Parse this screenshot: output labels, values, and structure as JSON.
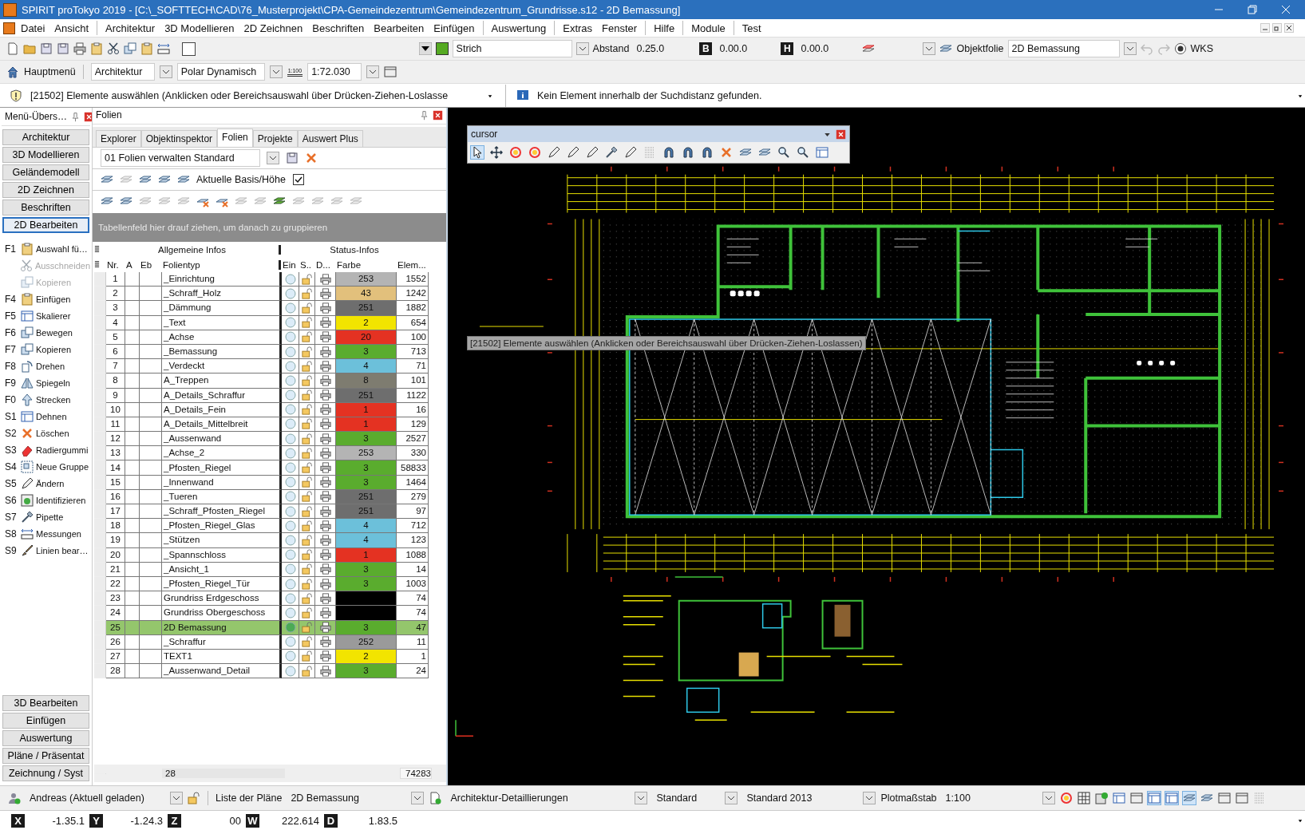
{
  "window": {
    "title": "SPIRIT proTokyo 2019  - [C:\\_SOFTTECH\\CAD\\76_Musterprojekt\\CPA-Gemeindezentrum\\Gemeindezentrum_Grundrisse.s12 - 2D Bemassung]"
  },
  "menu": [
    "Datei",
    "Ansicht",
    "Architektur",
    "3D Modellieren",
    "2D Zeichnen",
    "Beschriften",
    "Bearbeiten",
    "Einfügen",
    "Auswertung",
    "Extras",
    "Fenster",
    "Hilfe",
    "Module",
    "Test"
  ],
  "toolbar": {
    "line_type": "Strich",
    "abstand_label": "Abstand",
    "abstand": "0.25.0",
    "b_key": "B",
    "b_value": "0.00.0",
    "h_key": "H",
    "h_value": "0.00.0",
    "objektfolie": "Objektfolie",
    "folie": "2D Bemassung",
    "wks": "WKS"
  },
  "toolbar2": {
    "home": "Hauptmenü",
    "category": "Architektur",
    "mode": "Polar Dynamisch",
    "scale_icon_text": "1:100",
    "scale": "1:72.030"
  },
  "messages": {
    "prompt": "[21502] Elemente auswählen (Anklicken oder Bereichsauswahl über Drücken-Ziehen-Loslasse",
    "info": "Kein Element innerhalb der Suchdistanz gefunden."
  },
  "menu_panel": {
    "title": "Menü-Übers…",
    "top_buttons": [
      {
        "label": "Architektur",
        "selected": false
      },
      {
        "label": "3D Modellieren",
        "selected": false
      },
      {
        "label": "Geländemodell",
        "selected": false
      },
      {
        "label": "2D Zeichnen",
        "selected": false
      },
      {
        "label": "Beschriften",
        "selected": false
      },
      {
        "label": "2D Bearbeiten",
        "selected": true
      }
    ],
    "functions": [
      {
        "key": "F1",
        "label": "Auswahl fü…",
        "disabled": false
      },
      {
        "label": "Ausschneiden",
        "disabled": true
      },
      {
        "label": "Kopieren",
        "disabled": true
      },
      {
        "key": "F4",
        "label": "Einfügen",
        "disabled": false
      },
      {
        "key": "F5",
        "label": "Skalierer",
        "disabled": false
      },
      {
        "key": "F6",
        "label": "Bewegen",
        "disabled": false
      },
      {
        "key": "F7",
        "label": "Kopieren",
        "disabled": false
      },
      {
        "key": "F8",
        "label": "Drehen",
        "disabled": false
      },
      {
        "key": "F9",
        "label": "Spiegeln",
        "disabled": false
      },
      {
        "key": "F0",
        "label": "Strecken",
        "disabled": false
      },
      {
        "key": "S1",
        "label": "Dehnen",
        "disabled": false
      },
      {
        "key": "S2",
        "label": "Löschen",
        "disabled": false
      },
      {
        "key": "S3",
        "label": "Radiergummi",
        "disabled": false
      },
      {
        "key": "S4",
        "label": "Neue Gruppe",
        "disabled": false
      },
      {
        "key": "S5",
        "label": "Ändern",
        "disabled": false
      },
      {
        "key": "S6",
        "label": "Identifizieren",
        "disabled": false
      },
      {
        "key": "S7",
        "label": "Pipette",
        "disabled": false
      },
      {
        "key": "S8",
        "label": "Messungen",
        "disabled": false
      },
      {
        "key": "S9",
        "label": "Linien bear…",
        "disabled": false
      }
    ],
    "bottom_buttons": [
      "3D Bearbeiten",
      "Einfügen",
      "Auswertung",
      "Pläne / Präsentat",
      "Zeichnung / Syst"
    ]
  },
  "folien_panel": {
    "title": "Folien",
    "tabs": [
      {
        "label": "Explorer",
        "selected": false
      },
      {
        "label": "Objektinspektor",
        "selected": false
      },
      {
        "label": "Folien",
        "selected": true
      },
      {
        "label": "Projekte",
        "selected": false
      },
      {
        "label": "Auswert Plus",
        "selected": false
      }
    ],
    "preset": "01 Folien verwalten Standard",
    "current_base": {
      "label": "Aktuelle Basis/Höhe",
      "checked": true
    },
    "group_hint": "Tabellenfeld hier drauf ziehen, um danach zu gruppieren",
    "table": {
      "group_headers": [
        "Allgemeine Infos",
        "Status-Infos"
      ],
      "columns": [
        "Nr.",
        "A",
        "Eb",
        "Folientyp",
        "Ein",
        "S..",
        "D...",
        "Farbe",
        "Elem..."
      ],
      "rows": [
        {
          "nr": "1",
          "name": "_Einrichtung",
          "farbe": "253",
          "color": "#b4b4b4",
          "elements": "1552",
          "selected": false
        },
        {
          "nr": "2",
          "name": "_Schraff_Holz",
          "farbe": "43",
          "color": "#e2c07c",
          "elements": "1242",
          "selected": false
        },
        {
          "nr": "3",
          "name": "_Dämmung",
          "farbe": "251",
          "color": "#6e6e6e",
          "elements": "1882",
          "selected": false
        },
        {
          "nr": "4",
          "name": "_Text",
          "farbe": "2",
          "color": "#f2e400",
          "elements": "654",
          "selected": false
        },
        {
          "nr": "5",
          "name": "_Achse",
          "farbe": "20",
          "color": "#e43222",
          "elements": "100",
          "selected": false
        },
        {
          "nr": "6",
          "name": "_Bemassung",
          "farbe": "3",
          "color": "#5aac2e",
          "elements": "713",
          "selected": false
        },
        {
          "nr": "7",
          "name": "_Verdeckt",
          "farbe": "4",
          "color": "#6cc0da",
          "elements": "71",
          "selected": false
        },
        {
          "nr": "8",
          "name": "A_Treppen",
          "farbe": "8",
          "color": "#7e7c70",
          "elements": "101",
          "selected": false
        },
        {
          "nr": "9",
          "name": "A_Details_Schraffur",
          "farbe": "251",
          "color": "#6e6e6e",
          "elements": "1122",
          "selected": false
        },
        {
          "nr": "10",
          "name": "A_Details_Fein",
          "farbe": "1",
          "color": "#e43222",
          "elements": "16",
          "selected": false
        },
        {
          "nr": "11",
          "name": "A_Details_Mittelbreit",
          "farbe": "1",
          "color": "#e43222",
          "elements": "129",
          "selected": false
        },
        {
          "nr": "12",
          "name": "_Aussenwand",
          "farbe": "3",
          "color": "#5aac2e",
          "elements": "2527",
          "selected": false
        },
        {
          "nr": "13",
          "name": "_Achse_2",
          "farbe": "253",
          "color": "#b4b4b4",
          "elements": "330",
          "selected": false
        },
        {
          "nr": "14",
          "name": "_Pfosten_Riegel",
          "farbe": "3",
          "color": "#5aac2e",
          "elements": "58833",
          "selected": false
        },
        {
          "nr": "15",
          "name": "_Innenwand",
          "farbe": "3",
          "color": "#5aac2e",
          "elements": "1464",
          "selected": false
        },
        {
          "nr": "16",
          "name": "_Tueren",
          "farbe": "251",
          "color": "#6e6e6e",
          "elements": "279",
          "selected": false
        },
        {
          "nr": "17",
          "name": "_Schraff_Pfosten_Riegel",
          "farbe": "251",
          "color": "#6e6e6e",
          "elements": "97",
          "selected": false
        },
        {
          "nr": "18",
          "name": "_Pfosten_Riegel_Glas",
          "farbe": "4",
          "color": "#6cc0da",
          "elements": "712",
          "selected": false
        },
        {
          "nr": "19",
          "name": "_Stützen",
          "farbe": "4",
          "color": "#6cc0da",
          "elements": "123",
          "selected": false
        },
        {
          "nr": "20",
          "name": "_Spannschloss",
          "farbe": "1",
          "color": "#e43222",
          "elements": "1088",
          "selected": false
        },
        {
          "nr": "21",
          "name": "_Ansicht_1",
          "farbe": "3",
          "color": "#5aac2e",
          "elements": "14",
          "selected": false
        },
        {
          "nr": "22",
          "name": "_Pfosten_Riegel_Tür",
          "farbe": "3",
          "color": "#5aac2e",
          "elements": "1003",
          "selected": false
        },
        {
          "nr": "23",
          "name": "Grundriss Erdgeschoss",
          "farbe": "",
          "color": "#000000",
          "elements": "74",
          "selected": false
        },
        {
          "nr": "24",
          "name": "Grundriss Obergeschoss",
          "farbe": "",
          "color": "#000000",
          "elements": "74",
          "selected": false
        },
        {
          "nr": "25",
          "name": "2D Bemassung",
          "farbe": "3",
          "color": "#5aac2e",
          "elements": "47",
          "selected": true
        },
        {
          "nr": "26",
          "name": "_Schraffur",
          "farbe": "252",
          "color": "#9a9a9a",
          "elements": "11",
          "selected": false
        },
        {
          "nr": "27",
          "name": "TEXT1",
          "farbe": "2",
          "color": "#f2e400",
          "elements": "1",
          "selected": false
        },
        {
          "nr": "28",
          "name": "_Aussenwand_Detail",
          "farbe": "3",
          "color": "#5aac2e",
          "elements": "24",
          "selected": false
        }
      ],
      "footer": {
        "count": "28",
        "total": "74283"
      }
    }
  },
  "canvas": {
    "cursor_toolbar": {
      "title": "cursor"
    },
    "tooltip": "[21502] Elemente auswählen (Anklicken oder Bereichsauswahl über Drücken-Ziehen-Loslassen)"
  },
  "status_bar": {
    "user": "Andreas (Aktuell geladen)",
    "plan_list_label": "Liste der Pläne",
    "plan": "2D Bemassung",
    "detail": "Architektur-Detaillierungen",
    "style": "Standard",
    "standard": "Standard 2013",
    "plot_label": "Plotmaßstab",
    "plot_scale": "1:100"
  },
  "coordinates": [
    {
      "axis": "X",
      "value": "-1.35.1"
    },
    {
      "axis": "Y",
      "value": "-1.24.3"
    },
    {
      "axis": "Z",
      "value": "00"
    },
    {
      "axis": "W",
      "value": "222.614"
    },
    {
      "axis": "D",
      "value": "1.83.5"
    }
  ]
}
